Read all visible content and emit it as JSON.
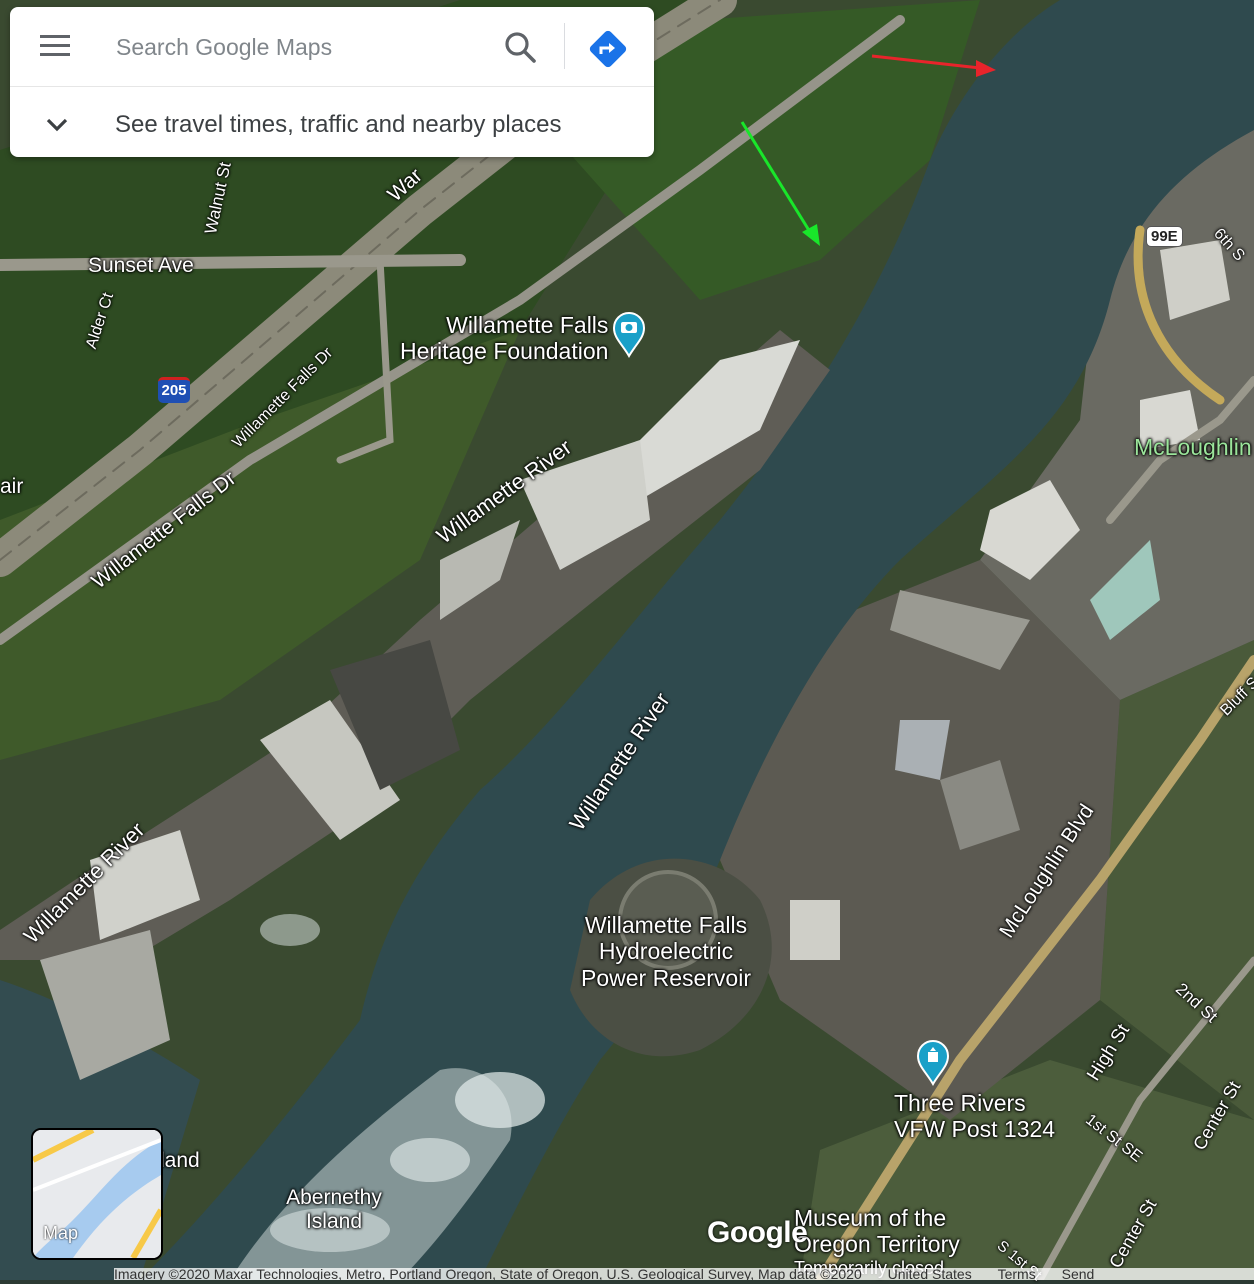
{
  "search": {
    "placeholder": "Search Google Maps",
    "subtitle": "See travel times, traffic and nearby places"
  },
  "icons": {
    "menu": "menu-icon",
    "search": "search-icon",
    "directions": "directions-icon",
    "expand": "chevron-down-icon",
    "camera_pin": "camera-pin-icon",
    "memorial_pin": "memorial-pin-icon"
  },
  "streets": {
    "war": "War",
    "walnut": "Walnut St",
    "sunset": "Sunset Ave",
    "alder": "Alder Ct",
    "interstate": "205",
    "wf_dr_upper": "Willamette Falls Dr",
    "wf_dr_lower": "Willamette Falls Dr",
    "air": "air",
    "river_top": "Willamette River",
    "river_mid": "Willamette River",
    "river_left": "Willamette River",
    "route_99e": "99E",
    "sixth": "6th S",
    "mcloughlin_top": "McLoughlin",
    "bluff": "Bluff S",
    "mcloughlin_blvd": "McLoughlin Blvd",
    "high": "High St",
    "second": "2nd St",
    "first_se": "1st St SE",
    "center_upper": "Center St",
    "center_lower": "Center St",
    "s_first": "S 1st St",
    "island_partial": "land"
  },
  "places": {
    "heritage_line1": "Willamette Falls",
    "heritage_line2": "Heritage Foundation",
    "reservoir_line1": "Willamette Falls",
    "reservoir_line2": "Hydroelectric",
    "reservoir_line3": "Power Reservoir",
    "abernethy_line1": "Abernethy",
    "abernethy_line2": "Island",
    "vfw_line1": "Three Rivers",
    "vfw_line2": "VFW Post 1324",
    "museum_line1": "Museum of the",
    "museum_line2": "Oregon Territory",
    "museum_status": "Temporarily closed"
  },
  "layer_toggle": {
    "label": "Map"
  },
  "logo": "Google",
  "footer": {
    "attribution": "Imagery ©2020 Maxar Technologies, Metro, Portland Oregon, State of Oregon, U.S. Geological Survey, Map data ©2020",
    "country": "United States",
    "terms": "Terms",
    "feedback": "Send"
  },
  "annotation_colors": {
    "red_arrow": "#e8242b",
    "green_arrow": "#19e62a"
  },
  "colors": {
    "directions": "#1a73e8",
    "pin": "#1aa0c8"
  }
}
